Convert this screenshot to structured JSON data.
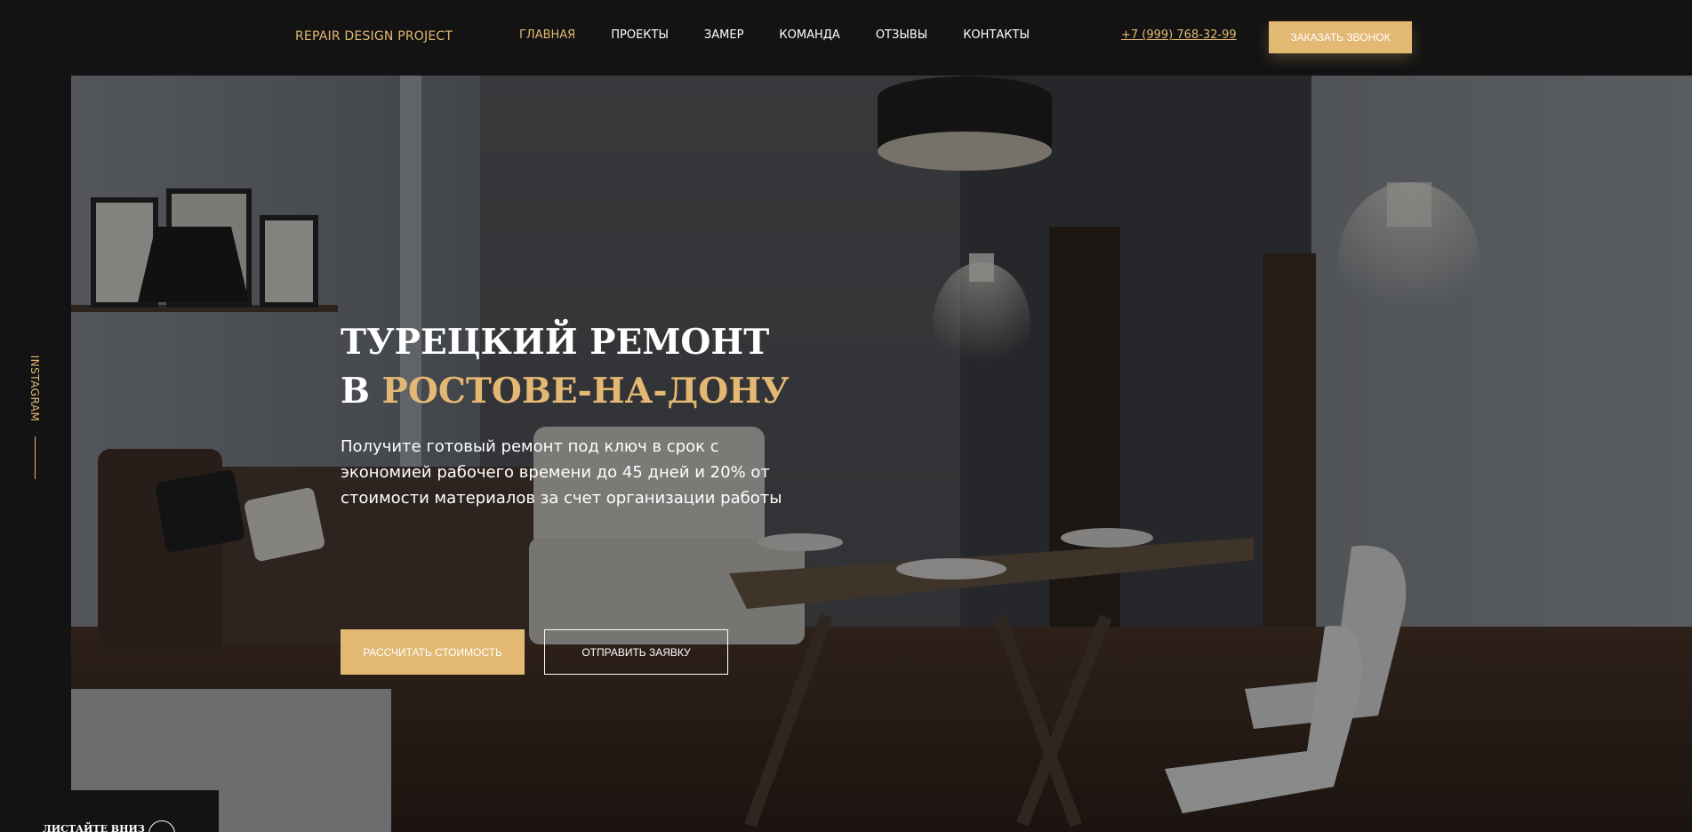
{
  "header": {
    "logo": "REPAIR DESIGN PROJECT",
    "nav": [
      {
        "label": "ГЛАВНАЯ",
        "active": true
      },
      {
        "label": "ПРОЕКТЫ",
        "active": false
      },
      {
        "label": "ЗАМЕР",
        "active": false
      },
      {
        "label": "КОМАНДА",
        "active": false
      },
      {
        "label": "ОТЗЫВЫ",
        "active": false
      },
      {
        "label": "КОНТАКТЫ",
        "active": false
      }
    ],
    "phone": "+7 (999) 768-32-99",
    "callback_label": "ЗАКАЗАТЬ ЗВОНОК"
  },
  "hero": {
    "title_line1": "ТУРЕЦКИЙ РЕМОНТ",
    "title_line2_prefix": "В",
    "title_line2_accent": "РОСТОВЕ-НА-ДОНУ",
    "subtitle": "Получите готовый ремонт под ключ в срок с экономией рабочего времени до 45 дней и 20% от стоимости материалов за счет организации работы",
    "primary_button": "РАССЧИТАТЬ СТОИМОСТЬ",
    "secondary_button": "ОТПРАВИТЬ ЗАЯВКУ"
  },
  "sidebar": {
    "instagram_label": "INSTAGRAM",
    "scroll_label": "ЛИСТАЙТЕ ВНИЗ"
  },
  "colors": {
    "accent": "#e3b873",
    "background": "#131313",
    "text": "#ffffff"
  }
}
